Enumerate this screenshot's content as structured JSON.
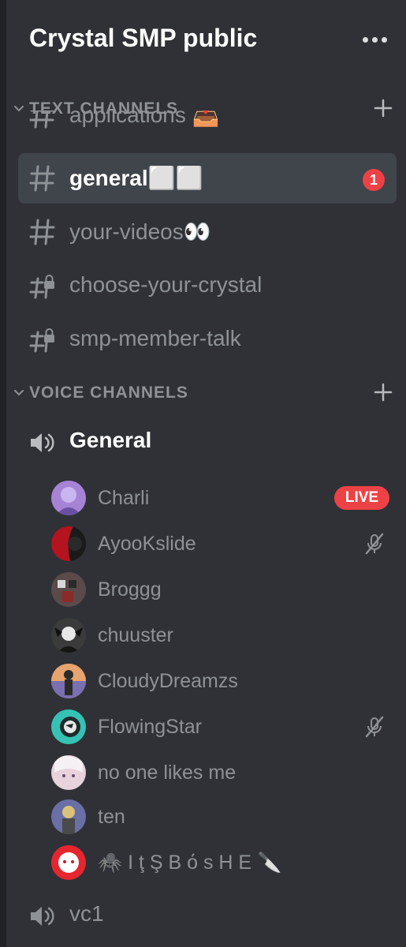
{
  "server": {
    "name": "Crystal SMP public"
  },
  "categories": {
    "text": {
      "label": "TEXT CHANNELS"
    },
    "voice": {
      "label": "VOICE CHANNELS"
    }
  },
  "text_channels": [
    {
      "name": "applications 📥",
      "icon": "hash-icon",
      "state": "partially-scrolled"
    },
    {
      "name": "general⬜⬜",
      "icon": "hash-icon",
      "selected": true,
      "mentions": "1"
    },
    {
      "name": "your-videos👀",
      "icon": "hash-icon"
    },
    {
      "name": "choose-your-crystal",
      "icon": "locked-hash-icon"
    },
    {
      "name": "smp-member-talk",
      "icon": "locked-hash-icon"
    }
  ],
  "voice_channels": [
    {
      "name": "General",
      "icon": "speaker-icon",
      "joined": true,
      "users": [
        {
          "name": "Charli",
          "avatar_color": "#a783d6",
          "status": "LIVE"
        },
        {
          "name": "AyooKslide",
          "avatar_color": "#b3141f",
          "muted": true
        },
        {
          "name": "Broggg",
          "avatar_color": "#5a4a4a"
        },
        {
          "name": "chuuster",
          "avatar_color": "#3b3b3b"
        },
        {
          "name": "CloudyDreamzs",
          "avatar_color": "#d98a55"
        },
        {
          "name": "FlowingStar",
          "avatar_color": "#35c2b5",
          "muted": true
        },
        {
          "name": "no one likes me",
          "avatar_color": "#e8d2dc"
        },
        {
          "name": "ten",
          "avatar_color": "#6a6fa6"
        },
        {
          "name": "🕷️ I ţ Ş B ό s H E 🔪",
          "avatar_color": "#e6262e"
        }
      ]
    },
    {
      "name": "vc1",
      "icon": "speaker-icon"
    }
  ],
  "colors": {
    "background": "#2f3136",
    "selected_channel": "#40444b",
    "mention_badge": "#ed4245",
    "live_badge": "#ed4245",
    "text_muted": "#8e9297",
    "text_active": "#ffffff"
  }
}
